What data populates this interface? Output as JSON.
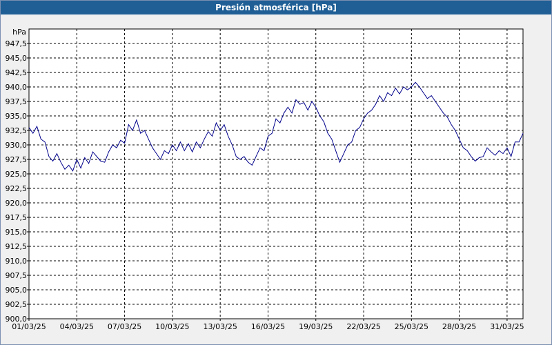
{
  "window": {
    "title": "Presión atmosférica [hPa]"
  },
  "colors": {
    "titlebar": "#1f5f96",
    "series": "#00008b",
    "grid": "#000000",
    "plot_bg": "#ffffff"
  },
  "chart_data": {
    "type": "line",
    "title": "Presión atmosférica [hPa]",
    "xlabel": "",
    "ylabel": "hPa",
    "grid": true,
    "ylim": [
      900.0,
      950.0
    ],
    "xlim": [
      "01/03/25",
      "01/04/25"
    ],
    "y_ticks": [
      "900,0",
      "902,5",
      "905,0",
      "907,5",
      "910,0",
      "912,5",
      "915,0",
      "917,5",
      "920,0",
      "922,5",
      "925,0",
      "927,5",
      "930,0",
      "932,5",
      "935,0",
      "937,5",
      "940,0",
      "942,5",
      "945,0",
      "947,5"
    ],
    "x_ticks": [
      "01/03/25",
      "04/03/25",
      "07/03/25",
      "10/03/25",
      "13/03/25",
      "16/03/25",
      "19/03/25",
      "22/03/25",
      "25/03/25",
      "28/03/25",
      "31/03/25"
    ],
    "series": [
      {
        "x": [
          "01/03/25 00:00",
          "01/03/25 06:00",
          "01/03/25 12:00",
          "01/03/25 18:00",
          "02/03/25 00:00",
          "02/03/25 06:00",
          "02/03/25 12:00",
          "02/03/25 18:00",
          "03/03/25 00:00",
          "03/03/25 06:00",
          "03/03/25 12:00",
          "03/03/25 18:00",
          "04/03/25 00:00",
          "04/03/25 06:00",
          "04/03/25 12:00",
          "04/03/25 18:00",
          "05/03/25 00:00",
          "05/03/25 06:00",
          "05/03/25 12:00",
          "05/03/25 18:00",
          "06/03/25 00:00",
          "06/03/25 06:00",
          "06/03/25 12:00",
          "06/03/25 18:00",
          "07/03/25 00:00",
          "07/03/25 06:00",
          "07/03/25 12:00",
          "07/03/25 18:00",
          "08/03/25 00:00",
          "08/03/25 06:00",
          "08/03/25 12:00",
          "08/03/25 18:00",
          "09/03/25 00:00",
          "09/03/25 06:00",
          "09/03/25 12:00",
          "09/03/25 18:00",
          "10/03/25 00:00",
          "10/03/25 06:00",
          "10/03/25 12:00",
          "10/03/25 18:00",
          "11/03/25 00:00",
          "11/03/25 06:00",
          "11/03/25 12:00",
          "11/03/25 18:00",
          "12/03/25 00:00",
          "12/03/25 06:00",
          "12/03/25 12:00",
          "12/03/25 18:00",
          "13/03/25 00:00",
          "13/03/25 06:00",
          "13/03/25 12:00",
          "13/03/25 18:00",
          "14/03/25 00:00",
          "14/03/25 06:00",
          "14/03/25 12:00",
          "14/03/25 18:00",
          "15/03/25 00:00",
          "15/03/25 06:00",
          "15/03/25 12:00",
          "15/03/25 18:00",
          "16/03/25 00:00",
          "16/03/25 06:00",
          "16/03/25 12:00",
          "16/03/25 18:00",
          "17/03/25 00:00",
          "17/03/25 06:00",
          "17/03/25 12:00",
          "17/03/25 18:00",
          "18/03/25 00:00",
          "18/03/25 06:00",
          "18/03/25 12:00",
          "18/03/25 18:00",
          "19/03/25 00:00",
          "19/03/25 06:00",
          "19/03/25 12:00",
          "19/03/25 18:00",
          "20/03/25 00:00",
          "20/03/25 06:00",
          "20/03/25 12:00",
          "20/03/25 18:00",
          "21/03/25 00:00",
          "21/03/25 06:00",
          "21/03/25 12:00",
          "21/03/25 18:00",
          "22/03/25 00:00",
          "22/03/25 06:00",
          "22/03/25 12:00",
          "22/03/25 18:00",
          "23/03/25 00:00",
          "23/03/25 06:00",
          "23/03/25 12:00",
          "23/03/25 18:00",
          "24/03/25 00:00",
          "24/03/25 06:00",
          "24/03/25 12:00",
          "24/03/25 18:00",
          "25/03/25 00:00",
          "25/03/25 06:00",
          "25/03/25 12:00",
          "25/03/25 18:00",
          "26/03/25 00:00",
          "26/03/25 06:00",
          "26/03/25 12:00",
          "26/03/25 18:00",
          "27/03/25 00:00",
          "27/03/25 06:00",
          "27/03/25 12:00",
          "27/03/25 18:00",
          "28/03/25 00:00",
          "28/03/25 06:00",
          "28/03/25 12:00",
          "28/03/25 18:00",
          "29/03/25 00:00",
          "29/03/25 06:00",
          "29/03/25 12:00",
          "29/03/25 18:00",
          "30/03/25 00:00",
          "30/03/25 06:00",
          "30/03/25 12:00",
          "30/03/25 18:00",
          "31/03/25 00:00",
          "31/03/25 06:00",
          "31/03/25 12:00",
          "31/03/25 18:00",
          "01/04/25 00:00"
        ],
        "y": [
          933.0,
          932.0,
          933.2,
          931.0,
          930.5,
          928.0,
          927.2,
          928.5,
          927.0,
          925.8,
          926.5,
          925.5,
          927.5,
          926.0,
          927.8,
          926.8,
          928.8,
          928.0,
          927.2,
          927.0,
          928.8,
          930.0,
          929.5,
          930.8,
          930.3,
          933.5,
          932.5,
          934.3,
          932.0,
          932.5,
          931.0,
          929.5,
          928.5,
          927.5,
          929.0,
          928.5,
          930.0,
          929.0,
          930.5,
          929.0,
          930.2,
          928.8,
          930.5,
          929.5,
          931.0,
          932.3,
          931.5,
          933.8,
          932.5,
          933.5,
          931.5,
          930.0,
          928.0,
          927.5,
          928.0,
          927.0,
          926.5,
          928.0,
          929.5,
          929.0,
          931.5,
          932.0,
          934.5,
          933.8,
          935.5,
          936.5,
          935.5,
          937.8,
          937.0,
          937.3,
          936.0,
          937.5,
          936.5,
          935.0,
          934.0,
          932.0,
          931.0,
          929.0,
          927.0,
          928.5,
          930.0,
          930.5,
          932.5,
          933.0,
          934.5,
          935.5,
          936.0,
          937.0,
          938.5,
          937.5,
          939.0,
          938.5,
          939.8,
          938.8,
          940.0,
          939.5,
          940.0,
          940.8,
          940.0,
          939.0,
          938.0,
          938.5,
          937.5,
          936.5,
          935.5,
          934.8,
          933.5,
          932.5,
          931.0,
          929.5,
          929.0,
          928.0,
          927.2,
          927.8,
          928.0,
          929.5,
          928.8,
          928.2,
          929.0,
          928.5,
          929.5,
          928.0,
          930.5,
          930.5,
          932.0
        ]
      }
    ]
  }
}
